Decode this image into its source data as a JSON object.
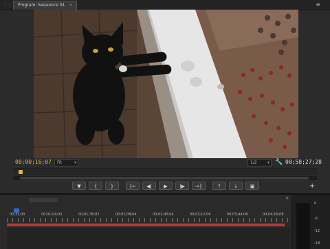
{
  "panel": {
    "tab_title": "Program: Sequence 01",
    "close_glyph": "×",
    "menu_glyph": "≡"
  },
  "monitor": {
    "timecode_current": "00;00;16;07",
    "fit_label": "Fit",
    "resolution_label": "1/2",
    "timecode_duration": "00;58;27;28",
    "dropdown_glyph": "▾",
    "wrench_icon": "wrench-icon",
    "accent_color": "#e8b23a"
  },
  "transport": {
    "buttons": [
      {
        "name": "add-marker-button",
        "glyph": "▼"
      },
      {
        "name": "mark-in-button",
        "glyph": "{"
      },
      {
        "name": "mark-out-button",
        "glyph": "}"
      },
      {
        "name": "go-to-in-button",
        "glyph": "{←"
      },
      {
        "name": "step-back-button",
        "glyph": "◀|"
      },
      {
        "name": "play-button",
        "glyph": "▶"
      },
      {
        "name": "step-forward-button",
        "glyph": "|▶"
      },
      {
        "name": "go-to-out-button",
        "glyph": "→}"
      },
      {
        "name": "lift-button",
        "glyph": "⇡"
      },
      {
        "name": "extract-button",
        "glyph": "⇣"
      },
      {
        "name": "export-frame-button",
        "glyph": "▣"
      }
    ],
    "add_glyph": "+"
  },
  "timeline": {
    "ruler_labels": [
      "00;32;00",
      "00;01;04;02",
      "00;01;36;02",
      "00;02;08;04",
      "00;02;40;04",
      "00;03;12;06",
      "00;03;44;06",
      "00;04;16;08"
    ],
    "clip_color": "#b33a3a",
    "close_glyph": "×"
  },
  "audio_meter": {
    "scale": [
      "0",
      "-6",
      "-12",
      "-18"
    ]
  }
}
